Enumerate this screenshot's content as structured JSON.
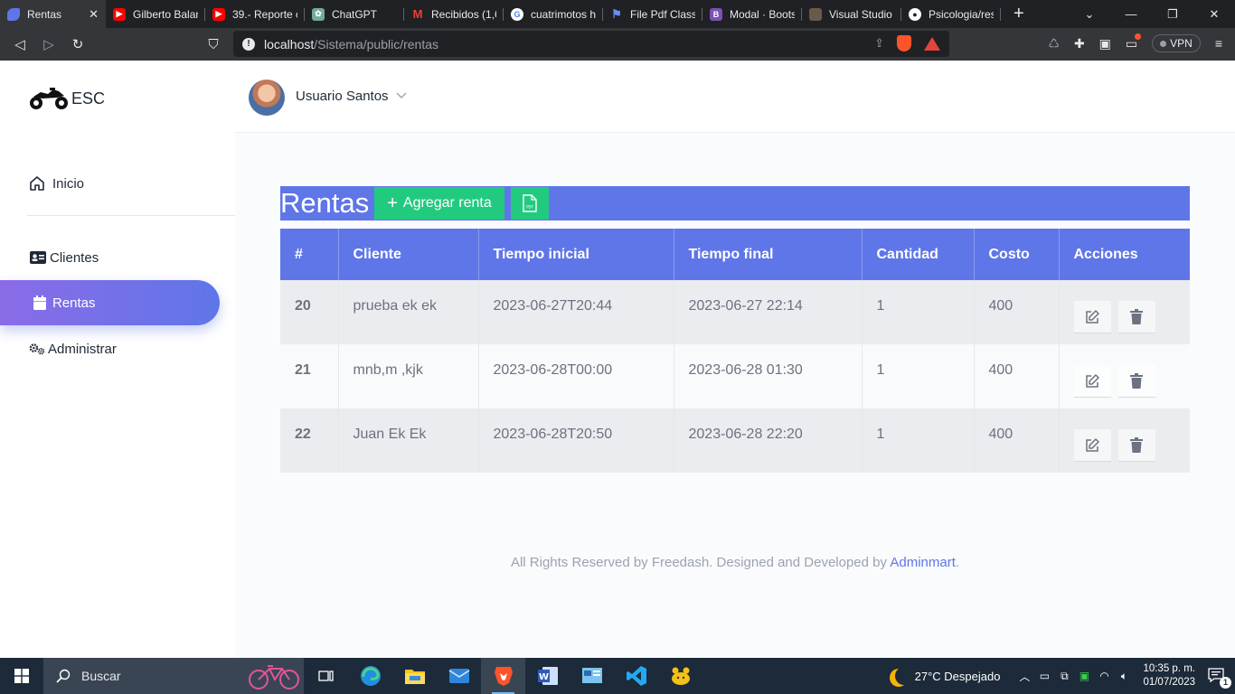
{
  "browser": {
    "tabs": [
      {
        "label": "Rentas",
        "fav_color": "#5f76e8",
        "active": true
      },
      {
        "label": "Gilberto Balan",
        "fav_color": "#ff0000"
      },
      {
        "label": "39.- Reporte c",
        "fav_color": "#ff0000"
      },
      {
        "label": "ChatGPT",
        "fav_color": "#74aa9c"
      },
      {
        "label": "Recibidos (1,6",
        "fav_color": "#ea4335"
      },
      {
        "label": "cuatrimotos h",
        "fav_color": "#4285f4"
      },
      {
        "label": "File Pdf Classi",
        "fav_color": "#4a6ee0"
      },
      {
        "label": "Modal · Boots",
        "fav_color": "#7952b3"
      },
      {
        "label": "Visual Studio",
        "fav_color": "#6b5a4a"
      },
      {
        "label": "Psicologia/res",
        "fav_color": "#ffffff"
      }
    ],
    "url_host": "localhost",
    "url_path": "/Sistema/public/rentas",
    "vpn_label": "VPN"
  },
  "sidebar": {
    "brand": "ESC",
    "items": [
      {
        "label": "Inicio",
        "icon": "home-icon"
      },
      {
        "label": "Clientes",
        "icon": "id-card-icon"
      },
      {
        "label": "Rentas",
        "icon": "calendar-icon",
        "active": true
      },
      {
        "label": "Administrar",
        "icon": "gears-icon"
      }
    ]
  },
  "header": {
    "username": "Usuario Santos"
  },
  "page": {
    "title": "Rentas",
    "add_label": "Agregar renta",
    "pdf_icon": "pdf-file-icon"
  },
  "table": {
    "columns": [
      "#",
      "Cliente",
      "Tiempo inicial",
      "Tiempo final",
      "Cantidad",
      "Costo",
      "Acciones"
    ],
    "rows": [
      {
        "id": "20",
        "cliente": "prueba ek ek",
        "inicio": "2023-06-27T20:44",
        "fin": "2023-06-27 22:14",
        "cantidad": "1",
        "costo": "400"
      },
      {
        "id": "21",
        "cliente": "mnb,m ,kjk",
        "inicio": "2023-06-28T00:00",
        "fin": "2023-06-28 01:30",
        "cantidad": "1",
        "costo": "400"
      },
      {
        "id": "22",
        "cliente": "Juan Ek Ek",
        "inicio": "2023-06-28T20:50",
        "fin": "2023-06-28 22:20",
        "cantidad": "1",
        "costo": "400"
      }
    ]
  },
  "footer": {
    "text": "All Rights Reserved by Freedash. Designed and Developed by ",
    "link": "Adminmart",
    "end": "."
  },
  "taskbar": {
    "search_label": "Buscar",
    "weather": "27°C  Despejado",
    "time": "10:35 p. m.",
    "date": "01/07/2023",
    "notifications": "1"
  },
  "colors": {
    "accent": "#5f76e8",
    "success": "#22ca80",
    "sidebar_active_gradient_start": "#8b6be8"
  }
}
